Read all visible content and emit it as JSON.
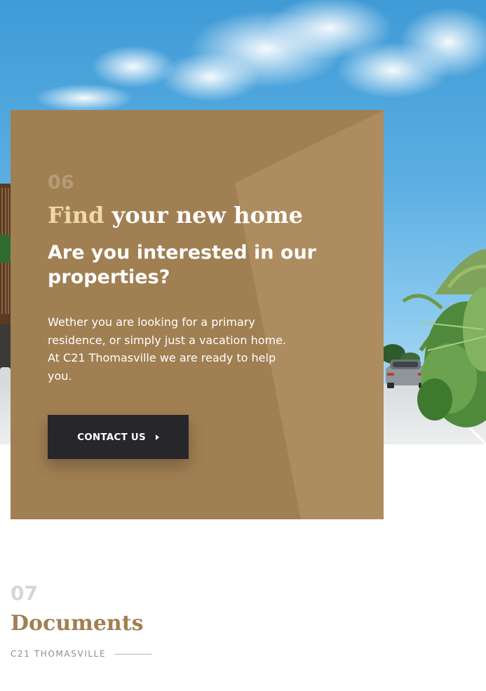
{
  "colors": {
    "brand_gold": "#a07f52",
    "accent_gold_text": "#f0d8a8",
    "button_dark": "#27272b",
    "sky_blue": "#4aa3dc",
    "muted_gray": "#8d8d8d"
  },
  "hero": {
    "image_description_icon": "photo"
  },
  "cta_section": {
    "number": "06",
    "title_accent": "Find",
    "title_rest": " your new home",
    "headline": "Are you interested in our properties?",
    "body": "Wether you are looking for a primary residence, or simply just a vacation home. At C21 Thomasville we are ready to help you.",
    "button_label": "CONTACT US",
    "button_icon": "caret-right-icon"
  },
  "documents_section": {
    "number": "07",
    "title": "Documents",
    "subtitle": "C21 THOMASVILLE"
  }
}
